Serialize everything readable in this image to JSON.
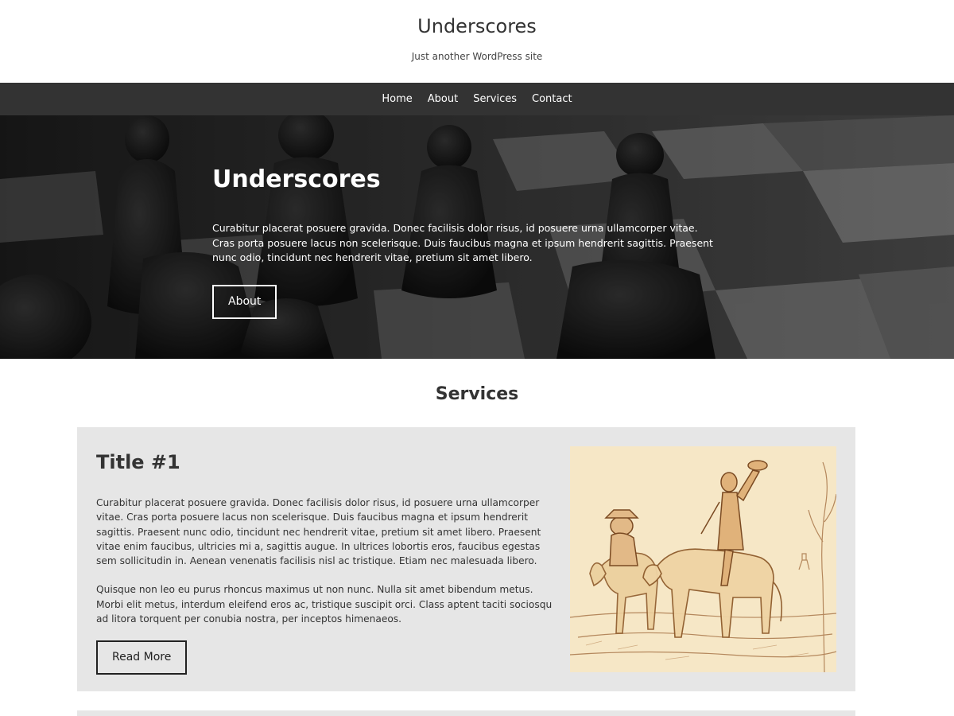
{
  "site": {
    "title": "Underscores",
    "description": "Just another WordPress site"
  },
  "nav": {
    "items": [
      {
        "label": "Home"
      },
      {
        "label": "About"
      },
      {
        "label": "Services"
      },
      {
        "label": "Contact"
      }
    ]
  },
  "hero": {
    "title": "Underscores",
    "text": "Curabitur placerat posuere gravida. Donec facilisis dolor risus, id posuere urna ullamcorper vitae. Cras porta posuere lacus non scelerisque. Duis faucibus magna et ipsum hendrerit sagittis. Praesent nunc odio, tincidunt nec hendrerit vitae, pretium sit amet libero.",
    "button_label": "About"
  },
  "services": {
    "heading": "Services",
    "items": [
      {
        "title": "Title #1",
        "paragraphs": [
          "Curabitur placerat posuere gravida. Donec facilisis dolor risus, id posuere urna ullamcorper vitae. Cras porta posuere lacus non scelerisque. Duis faucibus magna et ipsum hendrerit sagittis. Praesent nunc odio, tincidunt nec hendrerit vitae, pretium sit amet libero. Praesent vitae enim faucibus, ultricies mi a, sagittis augue. In ultrices lobortis eros, faucibus egestas sem sollicitudin in. Aenean venenatis facilisis nisl ac tristique. Etiam nec malesuada libero.",
          "Quisque non leo eu purus rhoncus maximus ut non nunc. Nulla sit amet bibendum metus. Morbi elit metus, interdum eleifend eros ac, tristique suscipit orci. Class aptent taciti sociosqu ad litora torquent per conubia nostra, per inceptos himenaeos."
        ],
        "button_label": "Read More"
      }
    ]
  },
  "colors": {
    "nav_background": "#333333",
    "card_background": "#e6e6e6",
    "text": "#333333"
  }
}
